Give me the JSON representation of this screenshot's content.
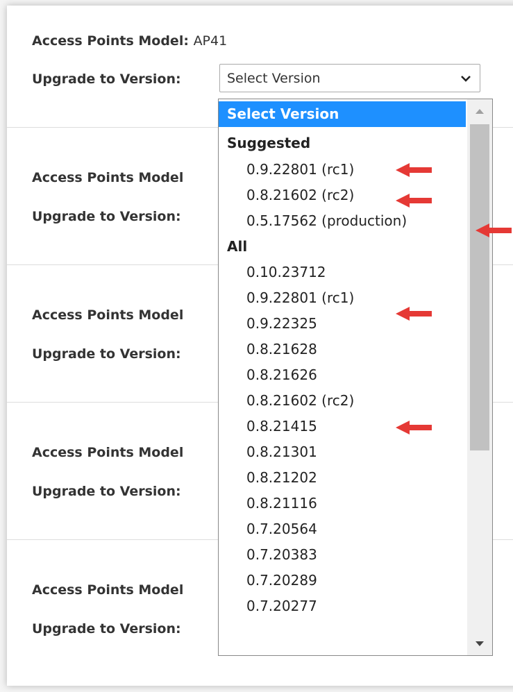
{
  "form": {
    "model_label": "Access Points Model:",
    "model_label_truncated": "Access Points Model",
    "model_value": "AP41",
    "upgrade_label": "Upgrade to Version:",
    "select_value": "Select Version"
  },
  "dropdown": {
    "selected_option": "Select Version",
    "groups": [
      {
        "label": "Suggested",
        "options": [
          "0.9.22801 (rc1)",
          "0.8.21602 (rc2)",
          "0.5.17562 (production)"
        ]
      },
      {
        "label": "All",
        "options": [
          "0.10.23712",
          "0.9.22801 (rc1)",
          "0.9.22325",
          "0.8.21628",
          "0.8.21626",
          "0.8.21602 (rc2)",
          "0.8.21415",
          "0.8.21301",
          "0.8.21202",
          "0.8.21116",
          "0.7.20564",
          "0.7.20383",
          "0.7.20289",
          "0.7.20277"
        ]
      }
    ]
  },
  "colors": {
    "highlight": "#1e90ff",
    "arrow": "#e53935"
  },
  "icons": {
    "select": "chevron-down-icon",
    "scroll_up": "triangle-up-icon",
    "scroll_down": "triangle-down-icon",
    "annotation": "red-arrow-icon"
  }
}
